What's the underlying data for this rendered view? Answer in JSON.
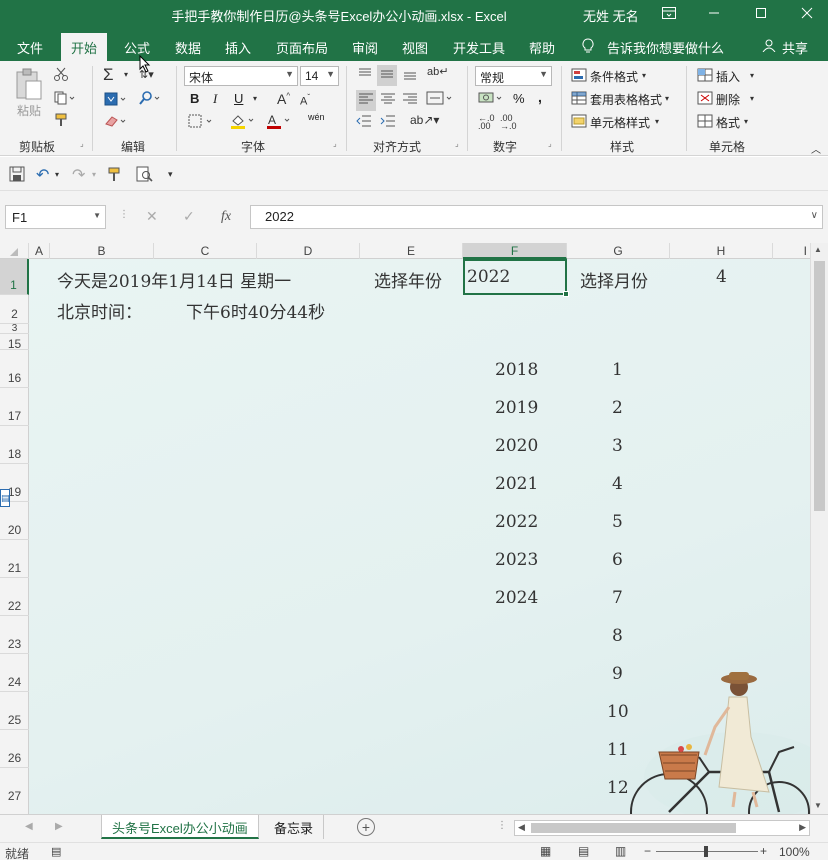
{
  "window": {
    "title": "手把手教你制作日历@头条号Excel办公小动画.xlsx  -  Excel",
    "user": "无姓 无名",
    "min_icon": "minimize-icon",
    "restore_icon": "restore-icon",
    "close_icon": "close-icon"
  },
  "menu": {
    "tabs": [
      "文件",
      "开始",
      "公式",
      "数据",
      "插入",
      "页面布局",
      "审阅",
      "视图",
      "开发工具",
      "帮助"
    ],
    "active": "开始",
    "tell_me": "告诉我你想要做什么",
    "share": "共享"
  },
  "ribbon": {
    "clipboard": {
      "paste": "粘贴",
      "label": "剪贴板"
    },
    "editing": {
      "label": "编辑"
    },
    "font": {
      "name": "宋体",
      "size": "14",
      "bold": "B",
      "italic": "I",
      "underline": "U",
      "label": "字体",
      "wen": "wén"
    },
    "alignment": {
      "label": "对齐方式"
    },
    "number": {
      "format": "常规",
      "percent": "%",
      "comma": ",",
      "label": "数字"
    },
    "styles": {
      "conditional": "条件格式",
      "table": "套用表格格式",
      "cell_styles": "单元格样式",
      "label": "样式"
    },
    "cells": {
      "insert": "插入",
      "delete": "删除",
      "format": "格式",
      "label": "单元格"
    }
  },
  "formula_bar": {
    "name_box": "F1",
    "fx": "fx",
    "value": "2022"
  },
  "columns": [
    "A",
    "B",
    "C",
    "D",
    "E",
    "F",
    "G",
    "H",
    "I"
  ],
  "rows": [
    "1",
    "2",
    "3",
    "15",
    "16",
    "17",
    "18",
    "19",
    "20",
    "21",
    "22",
    "23",
    "24",
    "25",
    "26",
    "27"
  ],
  "cells": {
    "b1": "今天是2019年1月14日  星期一",
    "e1": "选择年份",
    "f1": "2022",
    "g1": "选择月份",
    "h1": "4",
    "b2": "北京时间：",
    "c2": "下午6时40分44秒"
  },
  "years": [
    "2018",
    "2019",
    "2020",
    "2021",
    "2022",
    "2023",
    "2024"
  ],
  "months": [
    "1",
    "2",
    "3",
    "4",
    "5",
    "6",
    "7",
    "8",
    "9",
    "10",
    "11",
    "12"
  ],
  "sheets": {
    "tabs": [
      "头条号Excel办公小动画",
      "备忘录"
    ],
    "active": "头条号Excel办公小动画",
    "add": "+"
  },
  "status": {
    "ready": "就绪",
    "zoom": "100%"
  },
  "colors": {
    "accent": "#217346",
    "sheet_bg": "#e6f2f1"
  }
}
